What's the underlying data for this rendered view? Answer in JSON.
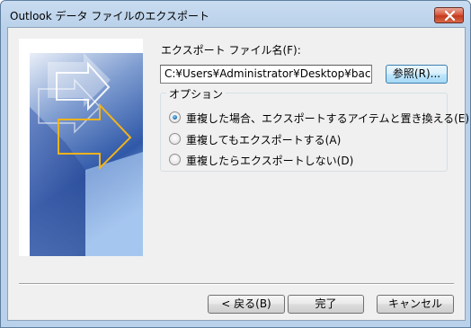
{
  "window": {
    "title": "Outlook データ ファイルのエクスポート",
    "close_icon": "close-icon"
  },
  "file": {
    "label": "エクスポート ファイル名(F):",
    "value": "C:¥Users¥Administrator¥Desktop¥backup.pst",
    "browse_label": "参照(R)..."
  },
  "options": {
    "legend": "オプション",
    "items": [
      {
        "label": "重複した場合、エクスポートするアイテムと置き換える(E)",
        "selected": true
      },
      {
        "label": "重複してもエクスポートする(A)",
        "selected": false
      },
      {
        "label": "重複したらエクスポートしない(D)",
        "selected": false
      }
    ]
  },
  "footer": {
    "back_label": "< 戻る(B)",
    "finish_label": "完了",
    "cancel_label": "キャンセル"
  }
}
